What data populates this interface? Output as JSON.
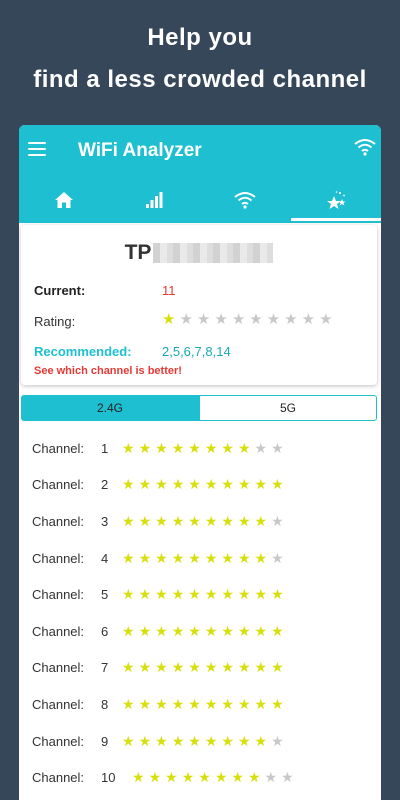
{
  "headline": {
    "line1": "Help you",
    "line2": "find a less crowded channel"
  },
  "app": {
    "title": "WiFi Analyzer",
    "tabs": [
      {
        "icon": "home-icon"
      },
      {
        "icon": "signal-bars-icon"
      },
      {
        "icon": "wifi-icon"
      },
      {
        "icon": "stars-icon",
        "active": true
      }
    ]
  },
  "card": {
    "ssid": "TP",
    "current_label": "Current:",
    "current_value": "11",
    "rating_label": "Rating:",
    "rating_stars": 1,
    "rating_max": 10,
    "recommended_label": "Recommended:",
    "recommended_value": "2,5,6,7,8,14",
    "hint": "See which channel is better!"
  },
  "bands": {
    "selected": "2.4G",
    "other": "5G"
  },
  "channel_label": "Channel:",
  "channels": [
    {
      "num": "1",
      "stars": 8
    },
    {
      "num": "2",
      "stars": 10
    },
    {
      "num": "3",
      "stars": 9
    },
    {
      "num": "4",
      "stars": 9
    },
    {
      "num": "5",
      "stars": 10
    },
    {
      "num": "6",
      "stars": 10
    },
    {
      "num": "7",
      "stars": 10
    },
    {
      "num": "8",
      "stars": 10
    },
    {
      "num": "9",
      "stars": 9
    },
    {
      "num": "10",
      "stars": 8
    }
  ],
  "colors": {
    "accent": "#1ebfd0",
    "background": "#37475a",
    "star_on": "#d7e00e",
    "star_off": "#c8c8c8",
    "alert": "#e53935"
  }
}
